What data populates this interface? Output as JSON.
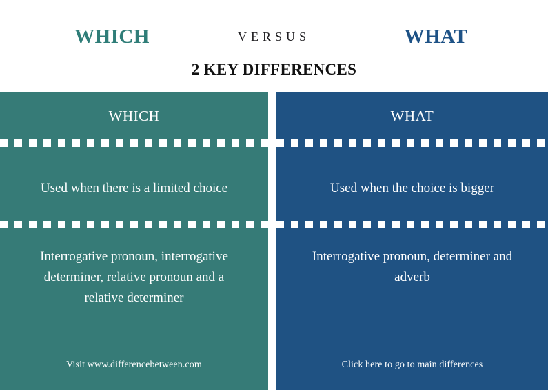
{
  "header": {
    "left_term": "WHICH",
    "versus": "VERSUS",
    "right_term": "WHAT",
    "left_color": "#2f7d78",
    "right_color": "#1e5286"
  },
  "subtitle": "2 KEY DIFFERENCES",
  "comparison": {
    "columns": [
      {
        "title": "WHICH",
        "bg_color": "#367b77",
        "rows": [
          "Used when there is a limited choice",
          "Interrogative pronoun, interrogative determiner, relative pronoun and a relative determiner"
        ],
        "footer": "Visit www.differencebetween.com"
      },
      {
        "title": "WHAT",
        "bg_color": "#1f5283",
        "rows": [
          "Used when the choice is bigger",
          "Interrogative pronoun, determiner and adverb"
        ],
        "footer": "Click here to go to main differences"
      }
    ]
  }
}
